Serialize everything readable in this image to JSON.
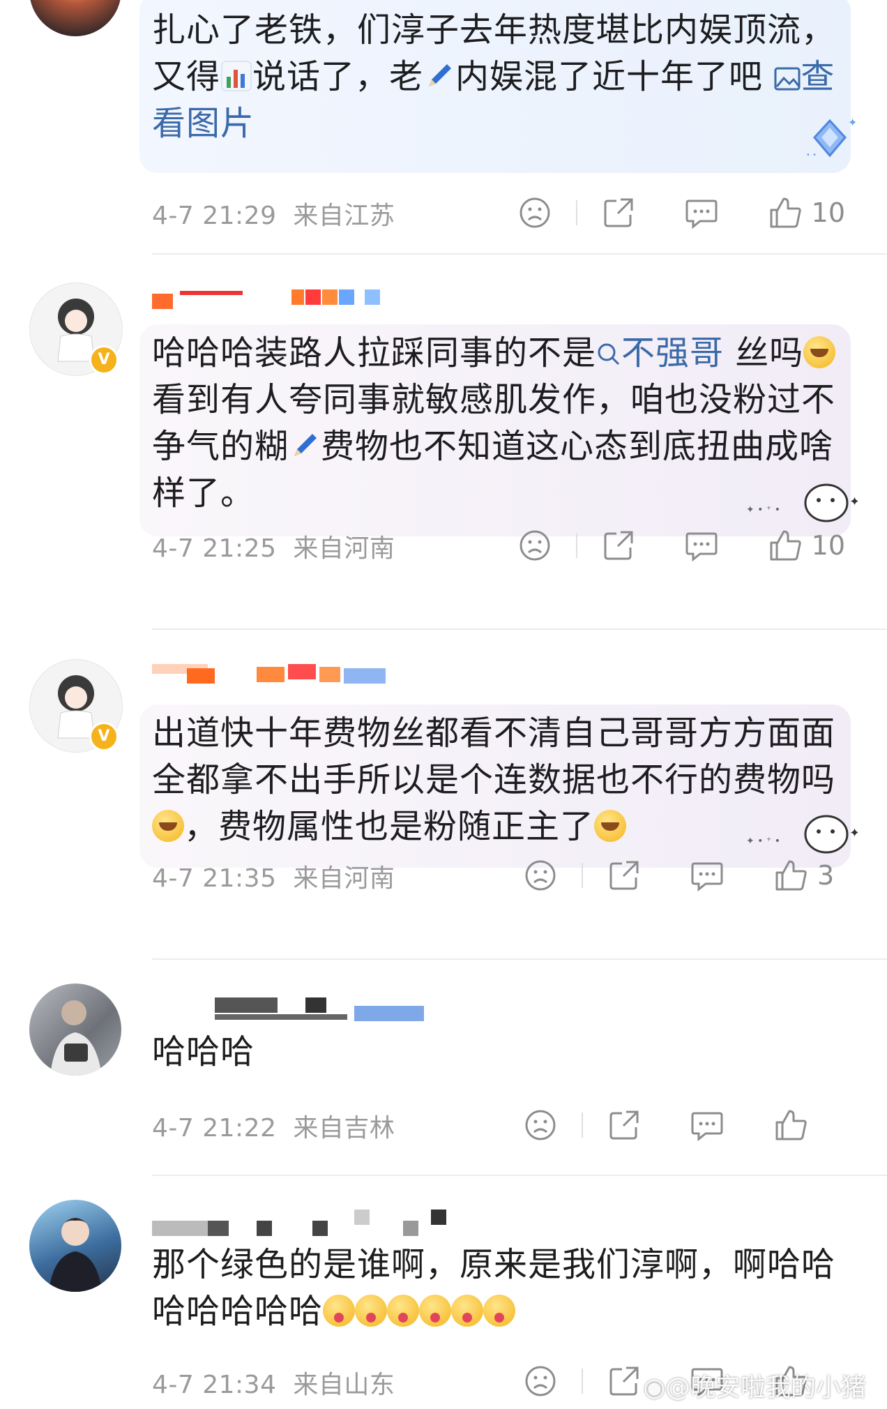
{
  "comments": [
    {
      "id": 1,
      "text_1": "扎心了老铁，们淳子去年热度堪比内娱顶流，又得",
      "text_2": "说话了，老",
      "text_3": "内娱混了近十年了吧",
      "link": "查看图片",
      "time": "4-7 21:29",
      "location": "来自江苏",
      "likes": "10"
    },
    {
      "id": 2,
      "text_1": "哈哈哈装路人拉踩同事的不是",
      "mention": "不强哥",
      "text_2": " 丝吗",
      "text_3": "看到有人夸同事就敏感肌发作，咱也没粉过不争气的糊",
      "text_4": "费物也不知道这心态到底扭曲成啥样了。",
      "time": "4-7 21:25",
      "location": "来自河南",
      "likes": "10"
    },
    {
      "id": 3,
      "text_1": "出道快十年费物丝都看不清自己哥哥方方面面全都拿不出手所以是个连数据也不行的费物吗",
      "text_2": "，费物属性也是粉随正主了",
      "time": "4-7 21:35",
      "location": "来自河南",
      "likes": "3"
    },
    {
      "id": 4,
      "text_1": "哈哈哈",
      "time": "4-7 21:22",
      "location": "来自吉林",
      "likes": ""
    },
    {
      "id": 5,
      "text_1": "那个绿色的是谁啊，原来是我们淳啊，啊哈哈哈哈哈哈哈",
      "time": "4-7 21:34",
      "location": "来自山东",
      "likes": ""
    }
  ],
  "watermark": "@晚安啦我的小猪",
  "icons": {
    "dislike": "sad-face-icon",
    "share": "share-icon",
    "reply": "comment-bubble-icon",
    "like": "thumbs-up-icon"
  },
  "colors": {
    "link": "#3b6aa8",
    "meta": "#9a9a9a",
    "verify_badge": "#f6b21b"
  }
}
